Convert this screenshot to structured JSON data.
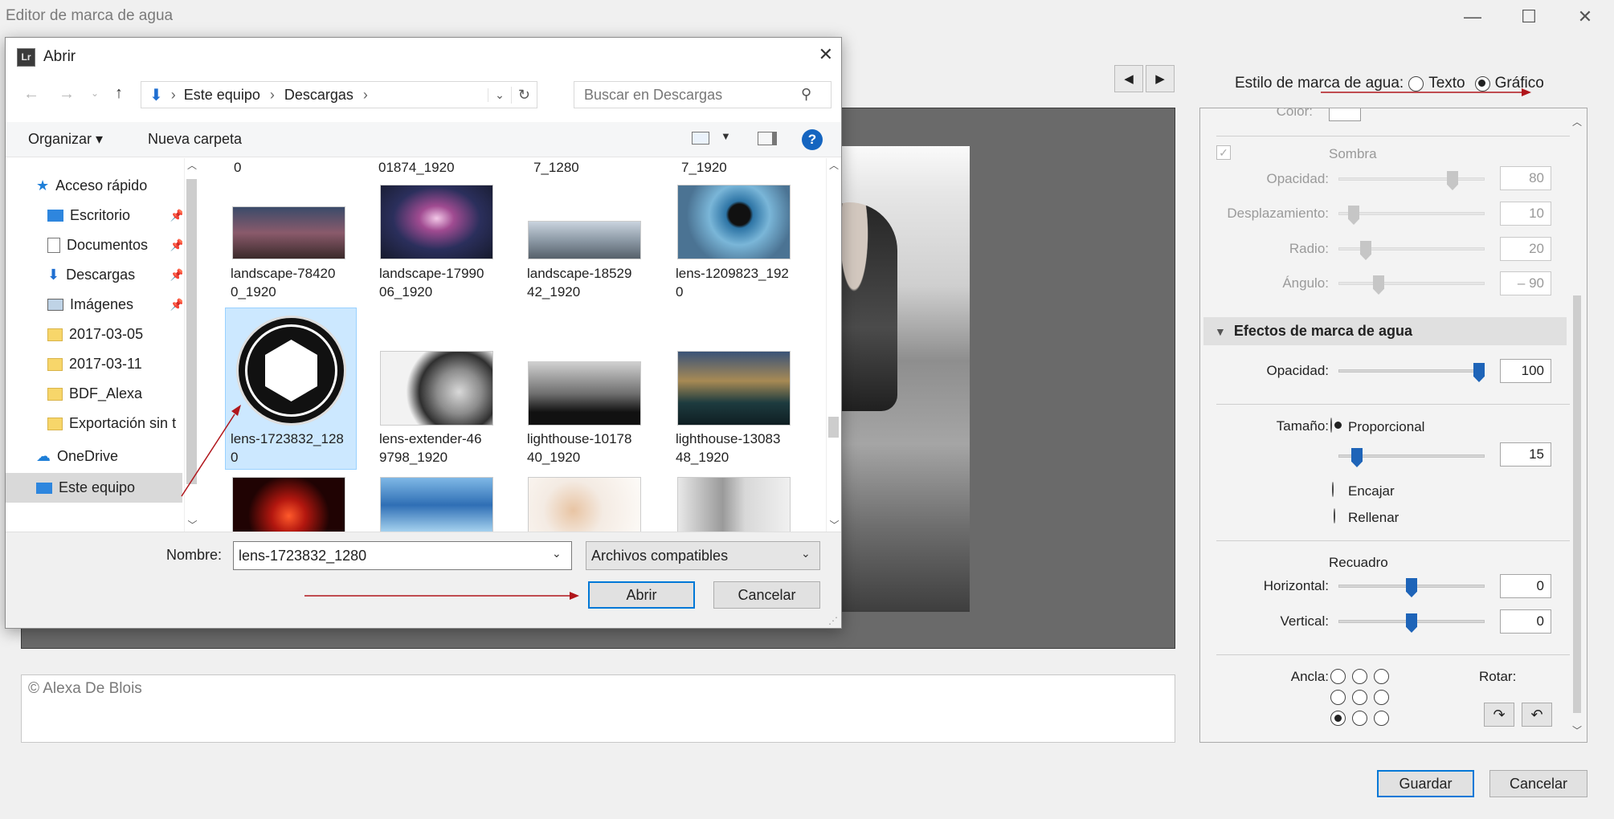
{
  "app": {
    "title": "Editor de marca de agua"
  },
  "window_controls": {
    "minimize": "—",
    "maximize": "☐",
    "close": "✕"
  },
  "preview_nav": {
    "prev": "◀",
    "next": "▶"
  },
  "watermark_style": {
    "label": "Estilo de marca de agua:",
    "text_option": "Texto",
    "graphic_option": "Gráfico",
    "selected": "Gráfico"
  },
  "text_field": {
    "value": "© Alexa De Blois"
  },
  "panel": {
    "color_label": "Color:",
    "shadow": {
      "label": "Sombra",
      "checked": true
    },
    "opacity_label": "Opacidad:",
    "opacity_value": "80",
    "offset_label": "Desplazamiento:",
    "offset_value": "10",
    "radius_label": "Radio:",
    "radius_value": "20",
    "angle_label": "Ángulo:",
    "angle_value": "– 90",
    "effects_header": "Efectos de marca de agua",
    "effects_opacity_label": "Opacidad:",
    "effects_opacity_value": "100",
    "size_label": "Tamaño:",
    "size_proportional": "Proporcional",
    "size_value": "15",
    "size_fit": "Encajar",
    "size_fill": "Rellenar",
    "inset_label": "Recuadro",
    "horizontal_label": "Horizontal:",
    "horizontal_value": "0",
    "vertical_label": "Vertical:",
    "vertical_value": "0",
    "anchor_label": "Ancla:",
    "rotate_label": "Rotar:"
  },
  "footer": {
    "save": "Guardar",
    "cancel": "Cancelar"
  },
  "dialog": {
    "title": "Abrir",
    "icon": "Lr",
    "close": "✕",
    "breadcrumb": [
      "Este equipo",
      "Descargas"
    ],
    "search_placeholder": "Buscar en Descargas",
    "organize": "Organizar",
    "new_folder": "Nueva carpeta",
    "help": "?",
    "nav": {
      "quick_access": "Acceso rápido",
      "items": [
        "Escritorio",
        "Documentos",
        "Descargas",
        "Imágenes",
        "2017-03-05",
        "2017-03-11",
        "BDF_Alexa",
        "Exportación sin t"
      ],
      "onedrive": "OneDrive",
      "this_pc": "Este equipo"
    },
    "top_row_captions": [
      "0",
      "01874_1920",
      "7_1280",
      "7_1920"
    ],
    "files": [
      {
        "l1": "landscape-78420",
        "l2": "0_1920"
      },
      {
        "l1": "landscape-17990",
        "l2": "06_1920"
      },
      {
        "l1": "landscape-18529",
        "l2": "42_1920"
      },
      {
        "l1": "lens-1209823_192",
        "l2": "0"
      },
      {
        "l1": "lens-1723832_128",
        "l2": "0"
      },
      {
        "l1": "lens-extender-46",
        "l2": "9798_1920"
      },
      {
        "l1": "lighthouse-10178",
        "l2": "40_1920"
      },
      {
        "l1": "lighthouse-13083",
        "l2": "48_1920"
      }
    ],
    "filename_label": "Nombre:",
    "filename_value": "lens-1723832_1280",
    "filetype": "Archivos compatibles",
    "open": "Abrir",
    "cancel": "Cancelar"
  },
  "colors": {
    "accent": "#0078d7",
    "slider_thumb": "#1e64b8",
    "annotation_arrow": "#b0151b",
    "selection": "#cce8ff"
  }
}
